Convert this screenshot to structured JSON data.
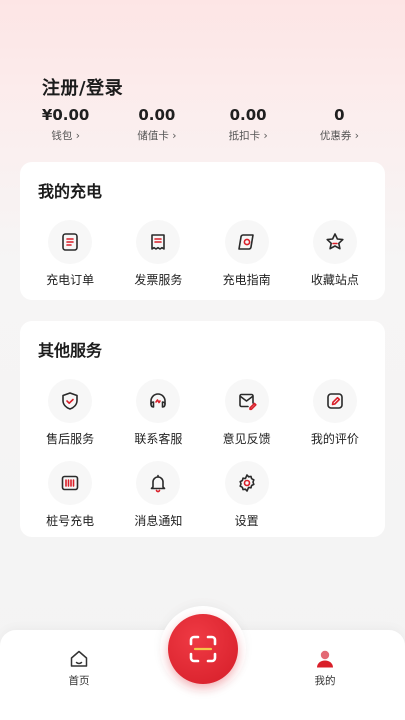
{
  "header": {
    "title": "注册/登录"
  },
  "stats": [
    {
      "value": "¥0.00",
      "label": "钱包"
    },
    {
      "value": "0.00",
      "label": "储值卡"
    },
    {
      "value": "0.00",
      "label": "抵扣卡"
    },
    {
      "value": "0",
      "label": "优惠券"
    }
  ],
  "my_charging": {
    "title": "我的充电",
    "items": [
      {
        "label": "充电订单",
        "icon": "order-list-icon"
      },
      {
        "label": "发票服务",
        "icon": "receipt-icon"
      },
      {
        "label": "充电指南",
        "icon": "compass-icon"
      },
      {
        "label": "收藏站点",
        "icon": "star-icon"
      }
    ]
  },
  "other_services": {
    "title": "其他服务",
    "items": [
      {
        "label": "售后服务",
        "icon": "shield-check-icon"
      },
      {
        "label": "联系客服",
        "icon": "headset-icon"
      },
      {
        "label": "意见反馈",
        "icon": "mail-edit-icon"
      },
      {
        "label": "我的评价",
        "icon": "edit-icon"
      },
      {
        "label": "桩号充电",
        "icon": "barcode-icon"
      },
      {
        "label": "消息通知",
        "icon": "bell-icon"
      },
      {
        "label": "设置",
        "icon": "gear-icon"
      }
    ]
  },
  "tabbar": {
    "home": "首页",
    "mine": "我的",
    "scan_icon": "scan-icon"
  },
  "colors": {
    "accent": "#d91f29",
    "icon_stroke": "#2a2a2a"
  }
}
